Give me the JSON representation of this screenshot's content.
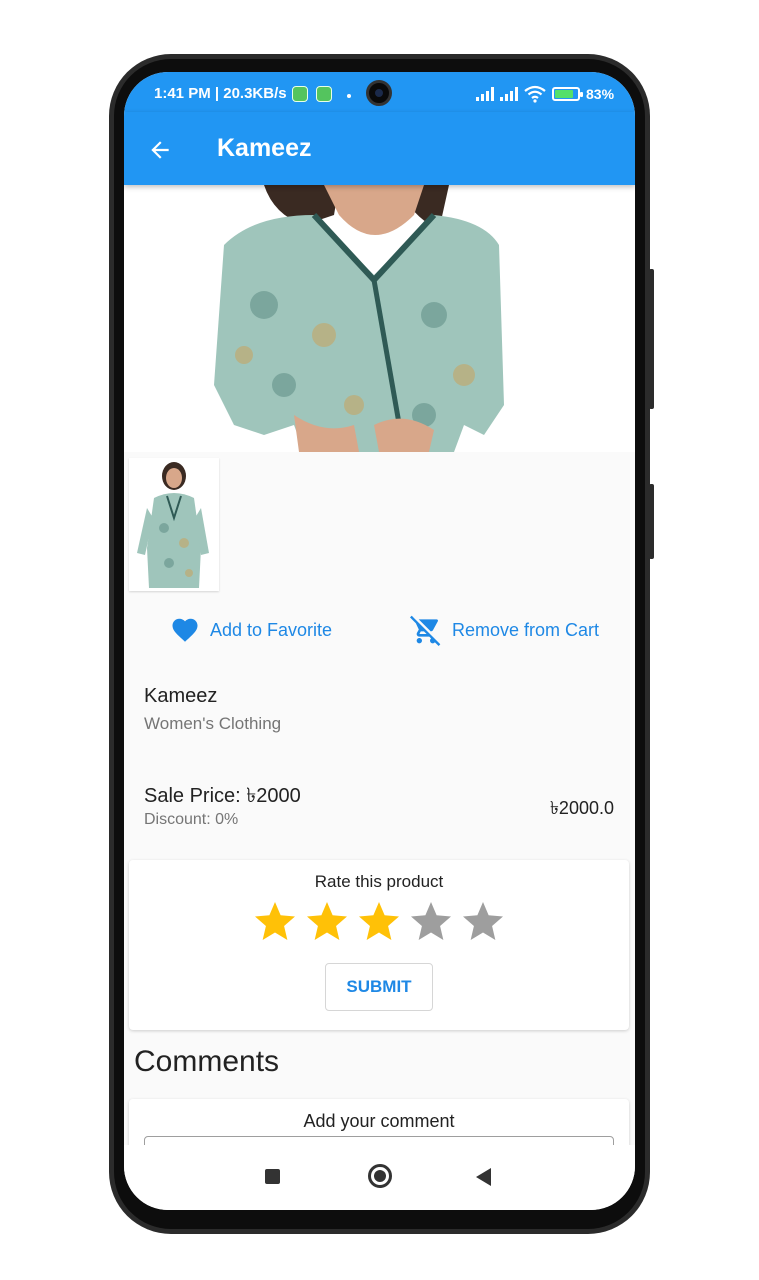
{
  "status_bar": {
    "time_speed": "1:41 PM | 20.3KB/s",
    "battery_percent": "83%",
    "icons": [
      "app-notification-icon",
      "app-notification-icon",
      "signal-icon",
      "signal-icon",
      "wifi-icon",
      "battery-charging-icon"
    ]
  },
  "app_bar": {
    "title": "Kameez",
    "back_icon": "arrow-left-icon"
  },
  "actions": {
    "favorite_label": "Add to Favorite",
    "favorite_icon": "heart-icon",
    "cart_label": "Remove from Cart",
    "cart_icon": "remove-shopping-cart-icon"
  },
  "product": {
    "name": "Kameez",
    "category": "Women's Clothing",
    "sale_price": "Sale Price: ৳2000",
    "discount": "Discount: 0%",
    "price": "৳2000.0"
  },
  "rating": {
    "title": "Rate this product",
    "value": 3,
    "max": 5,
    "submit_label": "SUBMIT"
  },
  "comments": {
    "title": "Comments",
    "add_label": "Add your comment"
  },
  "nav_bar": {
    "icons": [
      "recents-square-icon",
      "home-circle-icon",
      "back-triangle-icon"
    ]
  },
  "colors": {
    "primary": "#2196f3",
    "accent_text": "#1e88e5",
    "star_filled": "#ffc107",
    "star_empty": "#9e9e9e",
    "garment": "#9fc5bb"
  }
}
